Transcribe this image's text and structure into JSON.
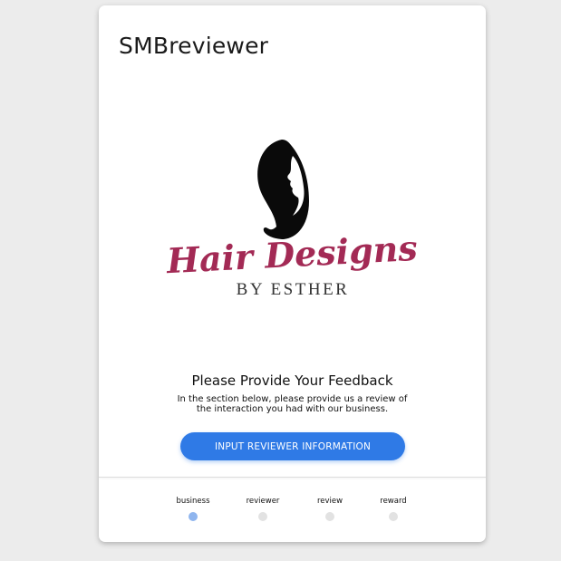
{
  "app": {
    "title": "SMBreviewer"
  },
  "logo": {
    "line1": "Hair Designs",
    "line2": "BY ESTHER",
    "colors": {
      "script": "#a32a55",
      "subtitle": "#333333",
      "silhouette": "#0a0a0a"
    }
  },
  "feedback": {
    "heading": "Please Provide Your Feedback",
    "description_line1": "In the section below, please provide us a review of",
    "description_line2": "the interaction you had with our business."
  },
  "cta": {
    "label": "INPUT REVIEWER INFORMATION"
  },
  "stepper": {
    "steps": [
      {
        "label": "business",
        "active": true
      },
      {
        "label": "reviewer",
        "active": false
      },
      {
        "label": "review",
        "active": false
      },
      {
        "label": "reward",
        "active": false
      }
    ]
  },
  "colors": {
    "accent": "#2f7ae6",
    "active_dot": "#8fb5ee",
    "inactive_dot": "#e2e2e2",
    "page_background": "#ececec"
  }
}
